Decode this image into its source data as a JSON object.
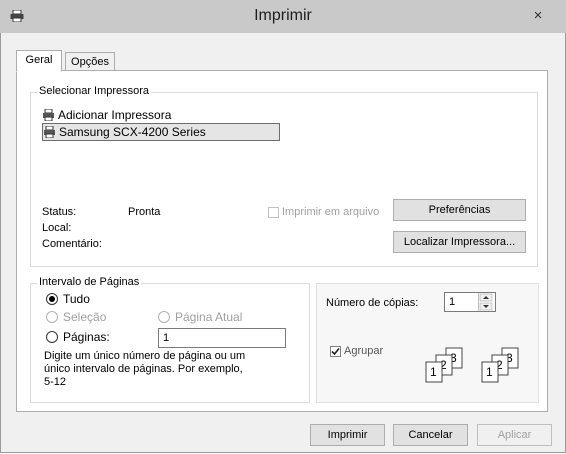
{
  "window": {
    "title": "Imprimir",
    "close_glyph": "×",
    "icon": "printer-icon"
  },
  "tabs": [
    {
      "label": "Geral",
      "active": true
    },
    {
      "label": "Opções",
      "active": false
    }
  ],
  "printer_select": {
    "legend": "Selecionar Impressora",
    "items": [
      {
        "label": "Adicionar Impressora",
        "icon": "add-printer-icon",
        "selected": false
      },
      {
        "label": "Samsung SCX-4200 Series",
        "icon": "printer-icon",
        "selected": true
      }
    ],
    "status_label": "Status:",
    "status_value": "Pronta",
    "location_label": "Local:",
    "comment_label": "Comentário:",
    "print_to_file_label": "Imprimir em arquivo",
    "preferences_button": "Preferências",
    "find_printer_button": "Localizar Impressora..."
  },
  "page_range": {
    "legend": "Intervalo de Páginas",
    "all_label": "Tudo",
    "selection_label": "Seleção",
    "current_page_label": "Página Atual",
    "pages_label": "Páginas:",
    "pages_value": "1",
    "help_text_line1": "Digite um único número de página ou um",
    "help_text_line2": "único intervalo de páginas. Por exemplo,",
    "help_text_line3": "5-12",
    "selected": "all"
  },
  "copies": {
    "label": "Número de cópias:",
    "value": "1",
    "collate_label": "Agrupar",
    "collate_checked": true,
    "collate_pages": [
      "1",
      "2",
      "3"
    ]
  },
  "footer": {
    "print_button": "Imprimir",
    "cancel_button": "Cancelar",
    "apply_button": "Aplicar"
  }
}
